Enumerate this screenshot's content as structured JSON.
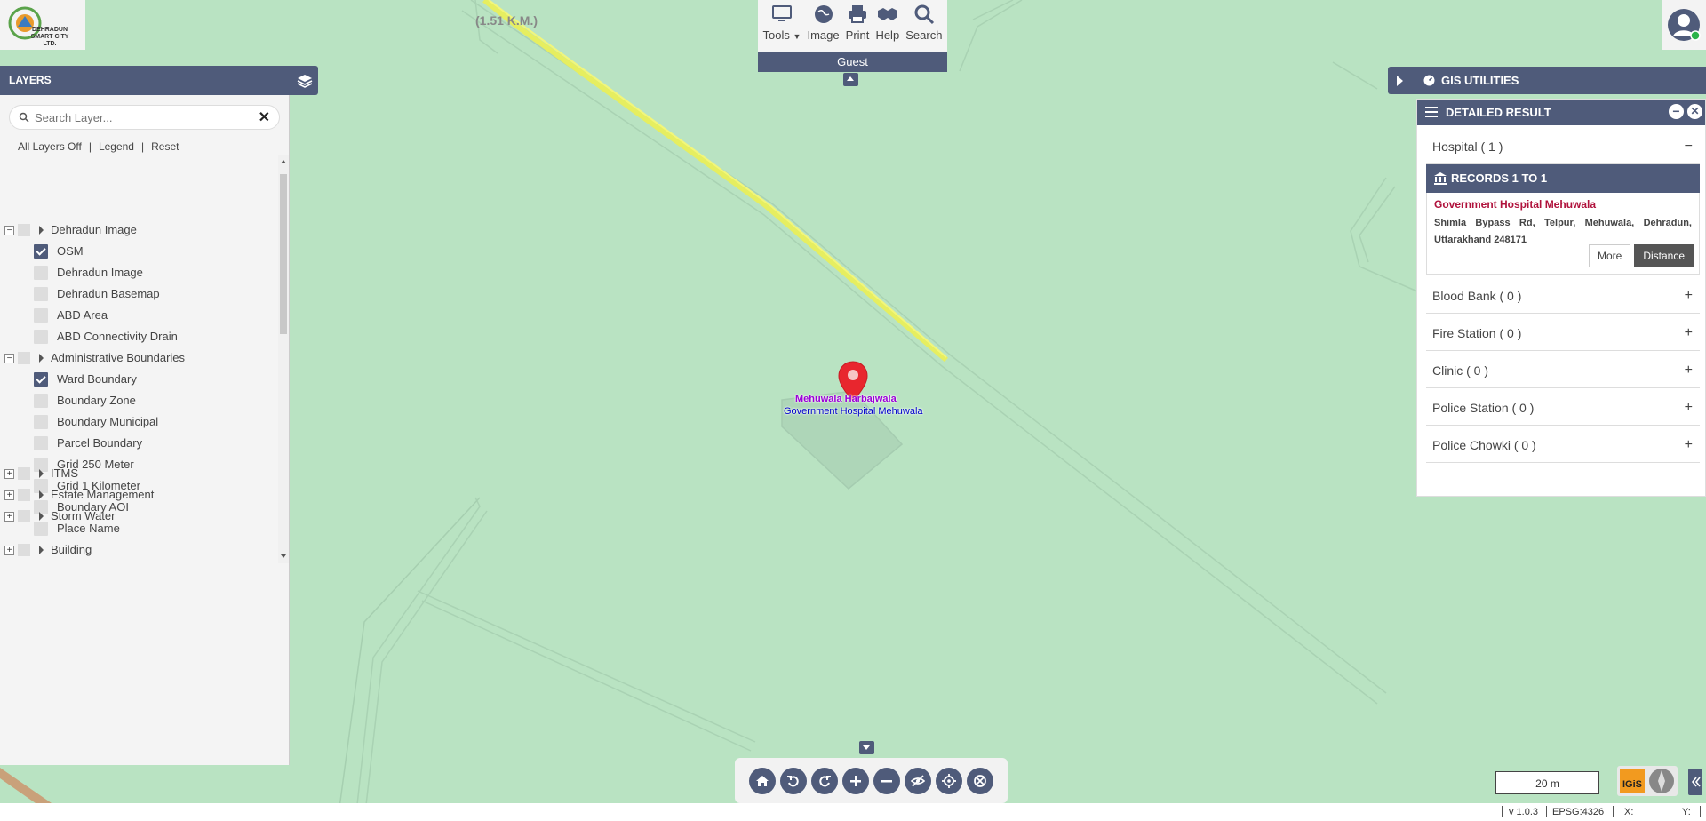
{
  "map": {
    "distance_label": "(1.51 K.M.)",
    "marker_place": "Mehuwala Harbajwala",
    "marker_name": "Government Hospital Mehuwala"
  },
  "logo": {
    "text": "DEHRADUN SMART CITY LTD."
  },
  "toolbar": {
    "tools_label": "Tools",
    "image_label": "Image",
    "print_label": "Print",
    "help_label": "Help",
    "search_label": "Search",
    "user_label": "Guest"
  },
  "layers": {
    "title": "LAYERS",
    "search_placeholder": "Search Layer...",
    "all_layers_off": "All Layers Off",
    "legend": "Legend",
    "reset": "Reset",
    "items": [
      {
        "label": "Dehradun Image",
        "type": "group"
      },
      {
        "label": "OSM",
        "type": "layer",
        "checked": true
      },
      {
        "label": "Dehradun Image",
        "type": "layer",
        "checked": false
      },
      {
        "label": "Dehradun Basemap",
        "type": "layer",
        "checked": false
      },
      {
        "label": "ABD Area",
        "type": "layer",
        "checked": false
      },
      {
        "label": "ABD Connectivity Drain",
        "type": "layer",
        "checked": false
      },
      {
        "label": "Administrative Boundaries",
        "type": "group"
      },
      {
        "label": "Ward Boundary",
        "type": "layer",
        "checked": true
      },
      {
        "label": "Boundary Zone",
        "type": "layer",
        "checked": false
      },
      {
        "label": "Boundary Municipal",
        "type": "layer",
        "checked": false
      },
      {
        "label": "Parcel Boundary",
        "type": "layer",
        "checked": false
      },
      {
        "label": "Grid 250 Meter",
        "type": "layer",
        "checked": false
      },
      {
        "label": "Grid 1 Kilometer",
        "type": "layer",
        "checked": false
      },
      {
        "label": "Boundary AOI",
        "type": "layer",
        "checked": false
      },
      {
        "label": "Place Name",
        "type": "layer",
        "checked": false
      },
      {
        "label": "Building",
        "type": "group-collapsed"
      },
      {
        "label": "ITMS",
        "type": "group-collapsed"
      },
      {
        "label": "Estate Management",
        "type": "group-collapsed"
      },
      {
        "label": "Storm Water",
        "type": "group-collapsed"
      }
    ]
  },
  "gis_utilities": {
    "title": "GIS UTILITIES"
  },
  "detailed_result": {
    "title": "DETAILED RESULT",
    "hospital_section": "Hospital ( 1 )",
    "records_label": "RECORDS 1 TO 1",
    "record": {
      "name": "Government Hospital Mehuwala",
      "address": "Shimla Bypass Rd, Telpur, Mehuwala, Dehradun, Uttarakhand 248171",
      "more_label": "More",
      "distance_label": "Distance"
    },
    "sections": [
      "Blood Bank ( 0 )",
      "Fire Station ( 0 )",
      "Clinic ( 0 )",
      "Police Station ( 0 )",
      "Police Chowki ( 0 )"
    ]
  },
  "scale": {
    "label": "20 m"
  },
  "footer": {
    "version": "v 1.0.3",
    "epsg": "EPSG:4326",
    "x_label": "X:",
    "y_label": "Y:"
  }
}
